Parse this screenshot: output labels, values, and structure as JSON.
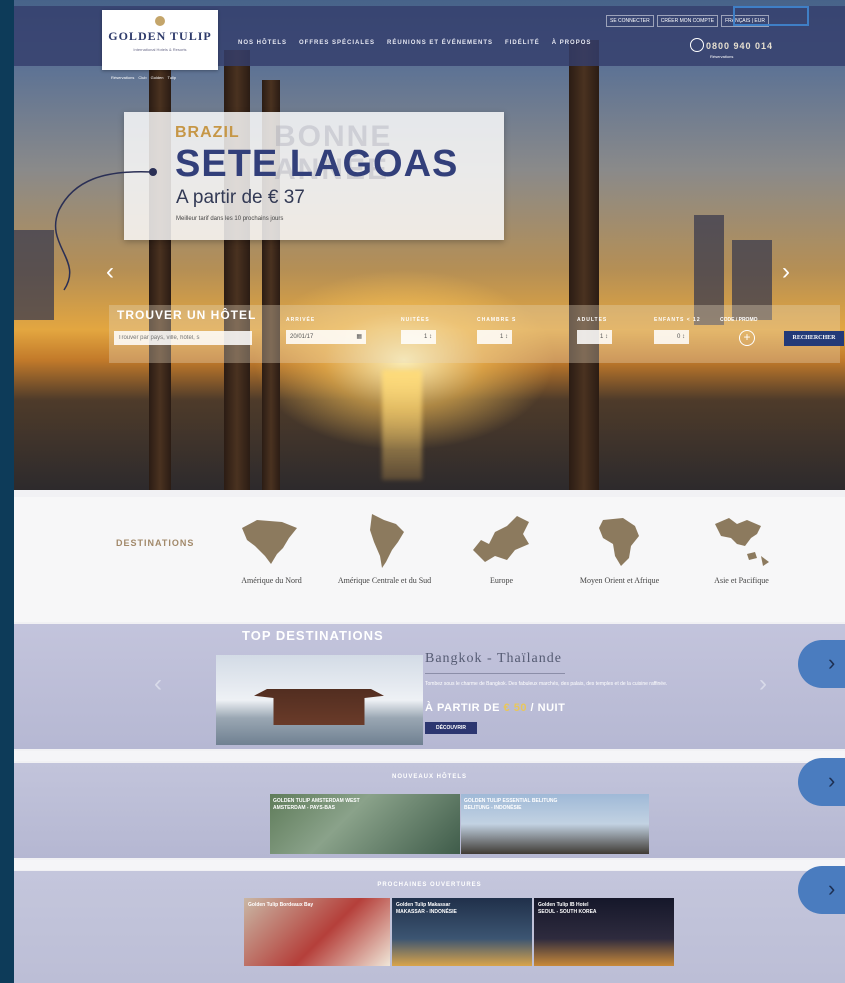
{
  "header": {
    "logo_name": "GOLDEN TULIP",
    "logo_tagline": "International Hotels & Resorts",
    "nav": [
      "NOS HÔTELS",
      "OFFRES SPÉCIALES",
      "RÉUNIONS ET ÉVÉNEMENTS",
      "FIDÉLITÉ",
      "À PROPOS"
    ],
    "util": {
      "login": "SE CONNECTER",
      "account": "CRÉER MON COMPTE",
      "language": "FRANÇAIS | EUR"
    },
    "phone": "0800 940 014",
    "phone_sub": "Réservations",
    "breadcrumb": [
      "Réservations",
      "Club",
      "Golden",
      "Tulip"
    ]
  },
  "hero": {
    "country": "BRAZIL",
    "city": "SETE LAGOAS",
    "price": "A partir de € 37",
    "note": "Meilleur tarif dans les 10 prochains jours",
    "ghost_text": "BONNE ANNÉE"
  },
  "search": {
    "title": "TROUVER UN HÔTEL",
    "placeholder": "Trouver par pays, ville, hôtel, s",
    "arrival_label": "ARRIVÉE",
    "arrival_value": "20/01/17",
    "nights_label": "NUITÉES",
    "nights_value": "1",
    "rooms_label": "CHAMBRE S",
    "rooms_value": "1",
    "adults_label": "ADULTES",
    "adults_value": "1",
    "children_label": "ENFANTS < 12",
    "children_value": "0",
    "promo_label": "CODE / PROMO",
    "button": "RECHERCHER"
  },
  "destinations": {
    "title": "DESTINATIONS",
    "regions": [
      "Amérique du Nord",
      "Amérique Centrale et du Sud",
      "Europe",
      "Moyen Orient et Afrique",
      "Asie et Pacifique"
    ]
  },
  "top_destinations": {
    "title": "TOP DESTINATIONS",
    "name": "Bangkok - Thaïlande",
    "desc": "Tombez sous le charme de Bangkok. Des fabuleux marchés, des palais, des temples et de la cuisine raffinée.",
    "price_prefix": "À PARTIR DE ",
    "price_value": "€ 50",
    "price_suffix": " / NUIT",
    "button": "DÉCOUVRIR"
  },
  "new_hotels": {
    "title": "NOUVEAUX HÔTELS",
    "cards": [
      {
        "name": "GOLDEN TULIP AMSTERDAM WEST",
        "place": "AMSTERDAM - PAYS-BAS"
      },
      {
        "name": "GOLDEN TULIP ESSENTIAL BELITUNG",
        "place": "BELITUNG - INDONÉSIE"
      }
    ]
  },
  "upcoming": {
    "title": "PROCHAINES OUVERTURES",
    "cards": [
      {
        "name": "Golden Tulip Bordeaux Bay"
      },
      {
        "name": "Golden Tulip Makassar",
        "place": "MAKASSAR - INDONÉSIE"
      },
      {
        "name": "Golden Tulip IB Hotel",
        "place": "SEOUL - SOUTH KOREA"
      }
    ]
  },
  "colors": {
    "navy": "#323f7a",
    "gold": "#c69747",
    "frame": "#0d3b59",
    "bubble": "#4a7cbf"
  }
}
